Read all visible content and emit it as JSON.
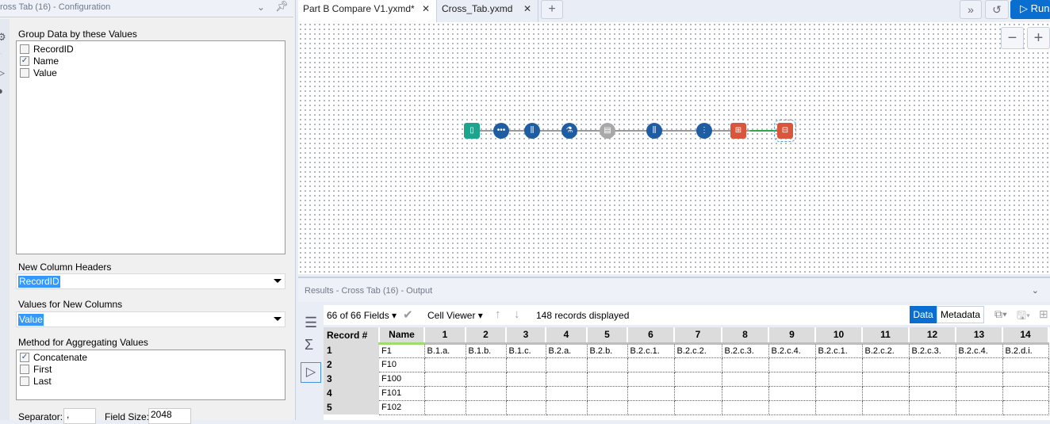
{
  "config": {
    "title": "ross Tab (16) - Configuration",
    "group_label": "Group Data by these Values",
    "group_fields": [
      {
        "label": "RecordID",
        "checked": false
      },
      {
        "label": "Name",
        "checked": true
      },
      {
        "label": "Value",
        "checked": false
      }
    ],
    "headers_label": "New Column Headers",
    "headers_value": "RecordID",
    "values_label": "Values for New Columns",
    "values_value": "Value",
    "method_label": "Method for Aggregating Values",
    "methods": [
      {
        "label": "Concatenate",
        "checked": true
      },
      {
        "label": "First",
        "checked": false
      },
      {
        "label": "Last",
        "checked": false
      }
    ],
    "separator_label": "Separator:",
    "separator_value": ",",
    "fieldsize_label": "Field Size:",
    "fieldsize_value": "2048"
  },
  "tabs": [
    {
      "label": "Part B Compare V1.yxmd*"
    },
    {
      "label": "Cross_Tab.yxmd"
    }
  ],
  "run_label": "Run",
  "results": {
    "title": "Results - Cross Tab (16) - Output",
    "fields": "66 of 66 Fields",
    "viewer": "Cell Viewer",
    "records": "148 records displayed",
    "data_tab": "Data",
    "metadata_tab": "Metadata",
    "columns": [
      "Record #",
      "Name",
      "1",
      "2",
      "3",
      "4",
      "5",
      "6",
      "7",
      "8",
      "9",
      "10",
      "11",
      "12",
      "13",
      "14"
    ],
    "rows": [
      [
        "1",
        "F1",
        "B.1.a.",
        "B.1.b.",
        "B.1.c.",
        "B.2.a.",
        "B.2.b.",
        "B.2.c.1.",
        "B.2.c.2.",
        "B.2.c.3.",
        "B.2.c.4.",
        "B.2.c.1.",
        "B.2.c.2.",
        "B.2.c.3.",
        "B.2.c.4.",
        "B.2.d.i."
      ],
      [
        "2",
        "F10",
        "",
        "",
        "",
        "",
        "",
        "",
        "",
        "",
        "",
        "",
        "",
        "",
        "",
        ""
      ],
      [
        "3",
        "F100",
        "",
        "",
        "",
        "",
        "",
        "",
        "",
        "",
        "",
        "",
        "",
        "",
        "",
        ""
      ],
      [
        "4",
        "F101",
        "",
        "",
        "",
        "",
        "",
        "",
        "",
        "",
        "",
        "",
        "",
        "",
        "",
        ""
      ],
      [
        "5",
        "F102",
        "",
        "",
        "",
        "",
        "",
        "",
        "",
        "",
        "",
        "",
        "",
        "",
        "",
        ""
      ]
    ]
  },
  "colors": {
    "accent": "#0a6ed1",
    "tool_blue": "#1e5da2",
    "tool_green": "#1aa58c",
    "tool_red": "#d9553b"
  }
}
